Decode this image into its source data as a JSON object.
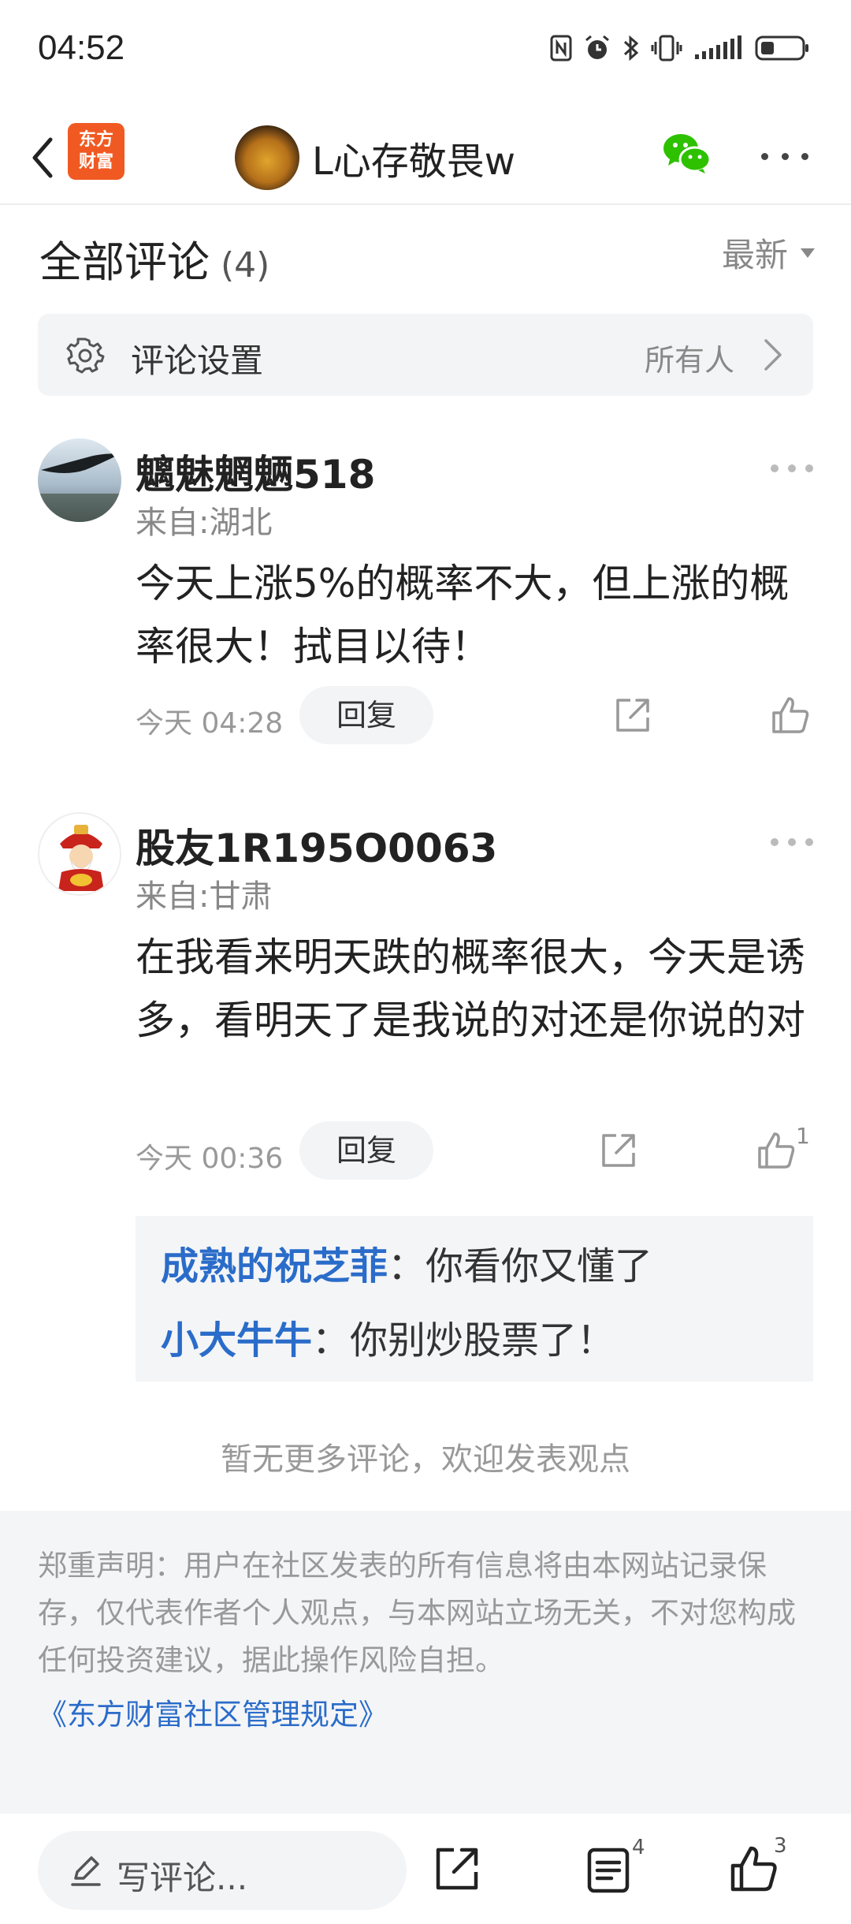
{
  "status_bar": {
    "time": "04:52",
    "icons": [
      "nfc-icon",
      "alarm-icon",
      "bluetooth-icon",
      "vibrate-icon",
      "signal-icon",
      "battery-icon"
    ]
  },
  "nav": {
    "back_icon": "chevron-left-icon",
    "app_logo": "东方\n财富",
    "app_logo_line1": "东方",
    "app_logo_line2": "财富",
    "user_name": "L心存敬畏w",
    "wechat_icon": "wechat-icon",
    "more_icon": "more-dots-icon"
  },
  "header": {
    "title": "全部评论",
    "count": "(4)",
    "sort_label": "最新"
  },
  "settings": {
    "icon": "gear-icon",
    "label": "评论设置",
    "value": "所有人"
  },
  "comments": [
    {
      "user": "魑魅魍魉518",
      "location": "来自:湖北",
      "text": "今天上涨5%的概率不大，但上涨的概率很大！拭目以待！",
      "time": "今天 04:28",
      "reply_label": "回复",
      "likes": ""
    },
    {
      "user": "股友1R195O0063",
      "location": "来自:甘肃",
      "text": "在我看来明天跌的概率很大，今天是诱多，看明天了是我说的对还是你说的对",
      "time": "今天 00:36",
      "reply_label": "回复",
      "likes": "1",
      "replies": [
        {
          "user": "成熟的祝芝菲",
          "text": "：你看你又懂了"
        },
        {
          "user": "小大牛牛",
          "text": "：你别炒股票了！"
        }
      ]
    }
  ],
  "no_more": "暂无更多评论，欢迎发表观点",
  "disclaimer": {
    "text": "郑重声明：用户在社区发表的所有信息将由本网站记录保存，仅代表作者个人观点，与本网站立场无关，不对您构成任何投资建议，据此操作风险自担。",
    "link": "《东方财富社区管理规定》"
  },
  "bottom_bar": {
    "write_placeholder": "写评论...",
    "comments_count": "4",
    "likes_count": "3"
  },
  "colors": {
    "accent_blue": "#2a6cc9",
    "brand_orange": "#f05a22",
    "wechat_green": "#2dc100"
  }
}
